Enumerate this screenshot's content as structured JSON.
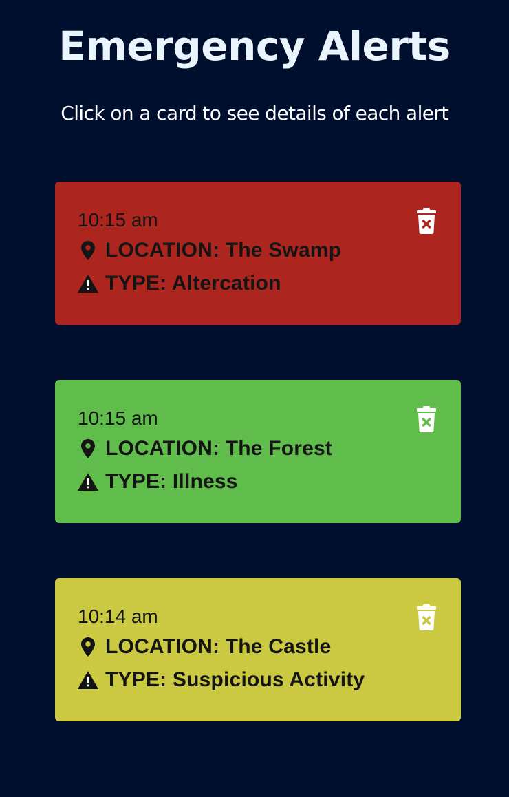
{
  "header": {
    "title": "Emergency Alerts",
    "subtitle": "Click on a card to see details of each alert"
  },
  "alerts": [
    {
      "time": "10:15 am",
      "location_text": "LOCATION: The Swamp",
      "type_text": "TYPE: Altercation",
      "color": "#ac261f",
      "location_icon": "map-pin-icon",
      "type_icon": "warning-triangle-icon",
      "delete_icon": "trash-icon"
    },
    {
      "time": "10:15 am",
      "location_text": "LOCATION: The Forest",
      "type_text": "TYPE: Illness",
      "color": "#60bd4b",
      "location_icon": "map-pin-icon",
      "type_icon": "warning-triangle-icon",
      "delete_icon": "trash-icon"
    },
    {
      "time": "10:14 am",
      "location_text": "LOCATION: The Castle",
      "type_text": "TYPE: Suspicious Activity",
      "color": "#cbc942",
      "location_icon": "map-pin-icon",
      "type_icon": "warning-triangle-icon",
      "delete_icon": "trash-icon"
    }
  ]
}
